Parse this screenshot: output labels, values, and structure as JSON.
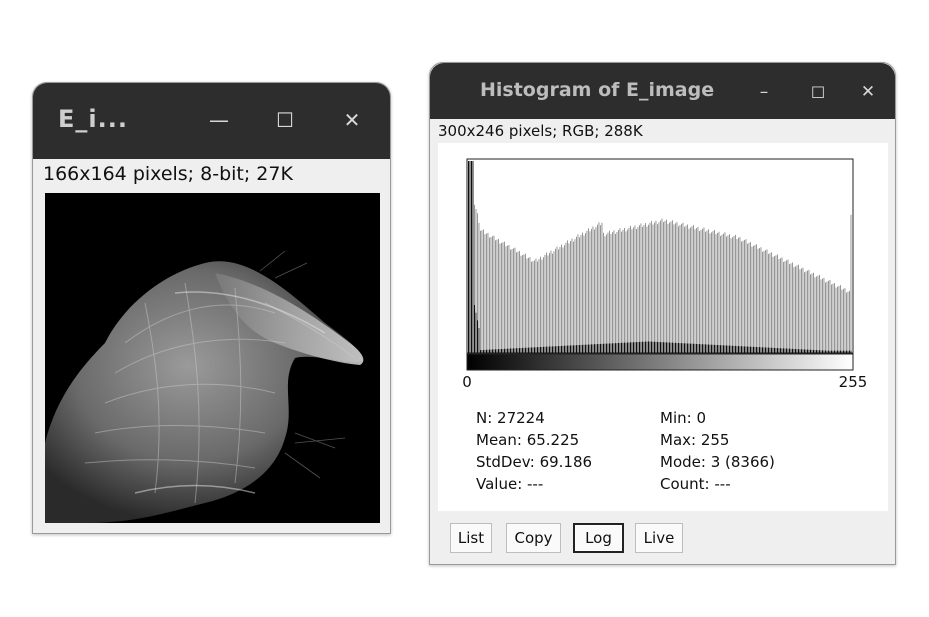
{
  "image_window": {
    "title": "E_i...",
    "minimize_glyph": "—",
    "maximize_glyph": "☐",
    "close_glyph": "✕",
    "info": "166x164 pixels; 8-bit; 27K"
  },
  "histogram_window": {
    "title": "Histogram of E_image",
    "minimize_glyph": "–",
    "maximize_glyph": "☐",
    "close_glyph": "✕",
    "info": "300x246 pixels; RGB; 288K",
    "axis_min_label": "0",
    "axis_max_label": "255",
    "stats": {
      "n": "N: 27224",
      "mean": "Mean: 65.225",
      "stddev": "StdDev: 69.186",
      "value": "Value: ---",
      "min": "Min: 0",
      "max": "Max: 255",
      "mode": "Mode: 3 (8366)",
      "count": "Count: ---"
    },
    "buttons": {
      "list": "List",
      "copy": "Copy",
      "log": "Log",
      "live": "Live"
    },
    "active_button": "log"
  },
  "chart_data": {
    "type": "bar",
    "x_range": [
      0,
      255
    ],
    "y_scale": "log",
    "description_bins": "Histogram of pixel values; log display (gray) overlaid on linear counts (black).",
    "mode_value": 3,
    "mode_count": 8366,
    "min": 0,
    "max": 255
  }
}
